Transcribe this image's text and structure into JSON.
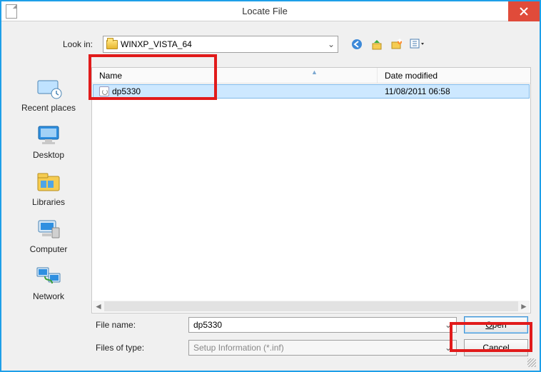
{
  "window": {
    "title": "Locate File"
  },
  "lookin": {
    "label": "Look in:",
    "value": "WINXP_VISTA_64"
  },
  "sidebar": {
    "items": [
      {
        "label": "Recent places"
      },
      {
        "label": "Desktop"
      },
      {
        "label": "Libraries"
      },
      {
        "label": "Computer"
      },
      {
        "label": "Network"
      }
    ]
  },
  "columns": {
    "name": "Name",
    "date": "Date modified"
  },
  "rows": [
    {
      "name": "dp5330",
      "date": "11/08/2011 06:58"
    }
  ],
  "filename": {
    "label": "File name:",
    "value": "dp5330"
  },
  "filetype": {
    "label": "Files of type:",
    "value": "Setup Information (*.inf)"
  },
  "buttons": {
    "open": "Open",
    "open_accel": "O",
    "open_rest": "pen",
    "cancel": "Cancel"
  }
}
